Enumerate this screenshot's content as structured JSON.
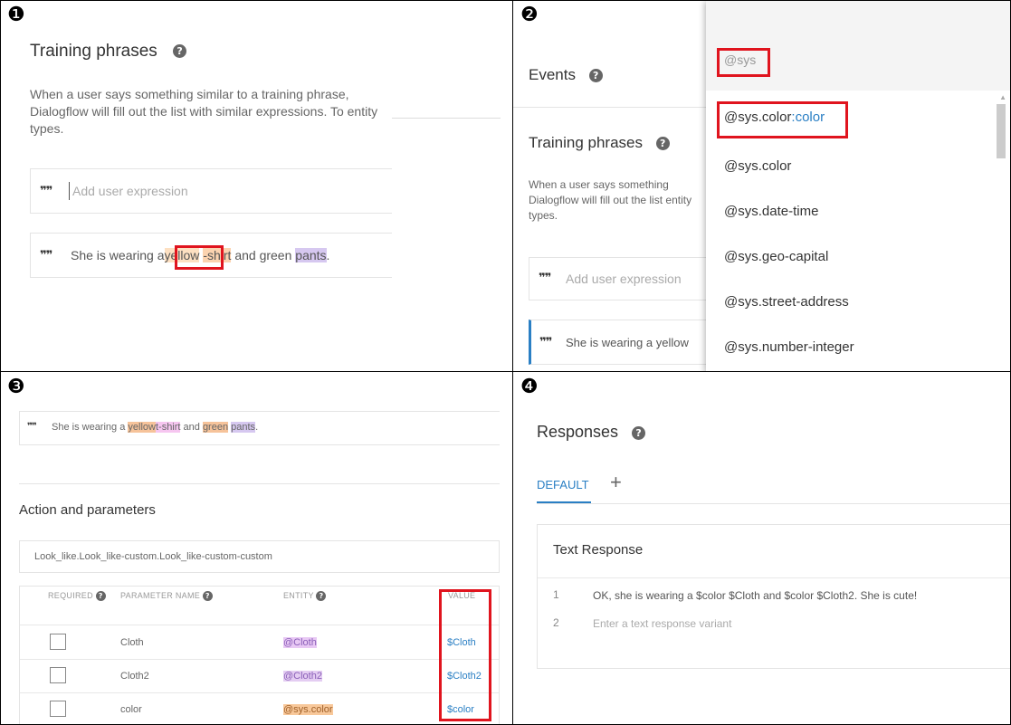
{
  "markers": [
    "❶",
    "❷",
    "❸",
    "❹"
  ],
  "panel1": {
    "title": "Training phrases",
    "description": "When a user says something similar to a training phrase, Dialogflow will fill out the list with similar expressions. To entity types.",
    "input_placeholder": "Add user expression",
    "phrase": {
      "prefix": "She is wearing a",
      "yellow": "yellow",
      "gap": " ",
      "tshirt": "-shirt",
      "mid": " and green ",
      "pants": "pants",
      "end": "."
    }
  },
  "panel2": {
    "events_label": "Events",
    "training_title": "Training phrases",
    "description": "When a user says something Dialogflow will fill out the list entity types.",
    "input_placeholder": "Add user expression",
    "phrase": "She is wearing a yellow",
    "search_value": "@sys",
    "options": [
      {
        "base": "@sys.color",
        "suffix": ":color"
      },
      {
        "base": "@sys.color",
        "suffix": ""
      },
      {
        "base": "@sys.date-time",
        "suffix": ""
      },
      {
        "base": "@sys.geo-capital",
        "suffix": ""
      },
      {
        "base": "@sys.street-address",
        "suffix": ""
      },
      {
        "base": "@sys.number-integer",
        "suffix": ""
      }
    ]
  },
  "panel3": {
    "phrase": {
      "prefix": "She is wearing a ",
      "yellow": "yellow",
      "tshirt": "t-shirt",
      "and": " and ",
      "green": "green",
      "pants": "pants",
      "end": "."
    },
    "section_title": "Action and parameters",
    "action_value": "Look_like.Look_like-custom.Look_like-custom-custom",
    "headers": {
      "required": "REQUIRED",
      "name": "PARAMETER NAME",
      "entity": "ENTITY",
      "value": "VALUE"
    },
    "rows": [
      {
        "name": "Cloth",
        "entity": "@Cloth",
        "value": "$Cloth"
      },
      {
        "name": "Cloth2",
        "entity": "@Cloth2",
        "value": "$Cloth2"
      },
      {
        "name": "color",
        "entity": "@sys.color",
        "value": "$color"
      }
    ]
  },
  "panel4": {
    "title": "Responses",
    "tab_default": "DEFAULT",
    "tab_add": "+",
    "card_title": "Text Response",
    "responses": [
      {
        "index": "1",
        "text": "OK, she is wearing a $color $Cloth and $color $Cloth2. She is cute!"
      },
      {
        "index": "2",
        "text": "Enter a text response variant"
      }
    ]
  },
  "colors": {
    "accent_blue": "#2a7fc4",
    "highlight_red": "#e0141e",
    "entity_purple": "#b98de0",
    "entity_orange": "#f6b27a"
  }
}
